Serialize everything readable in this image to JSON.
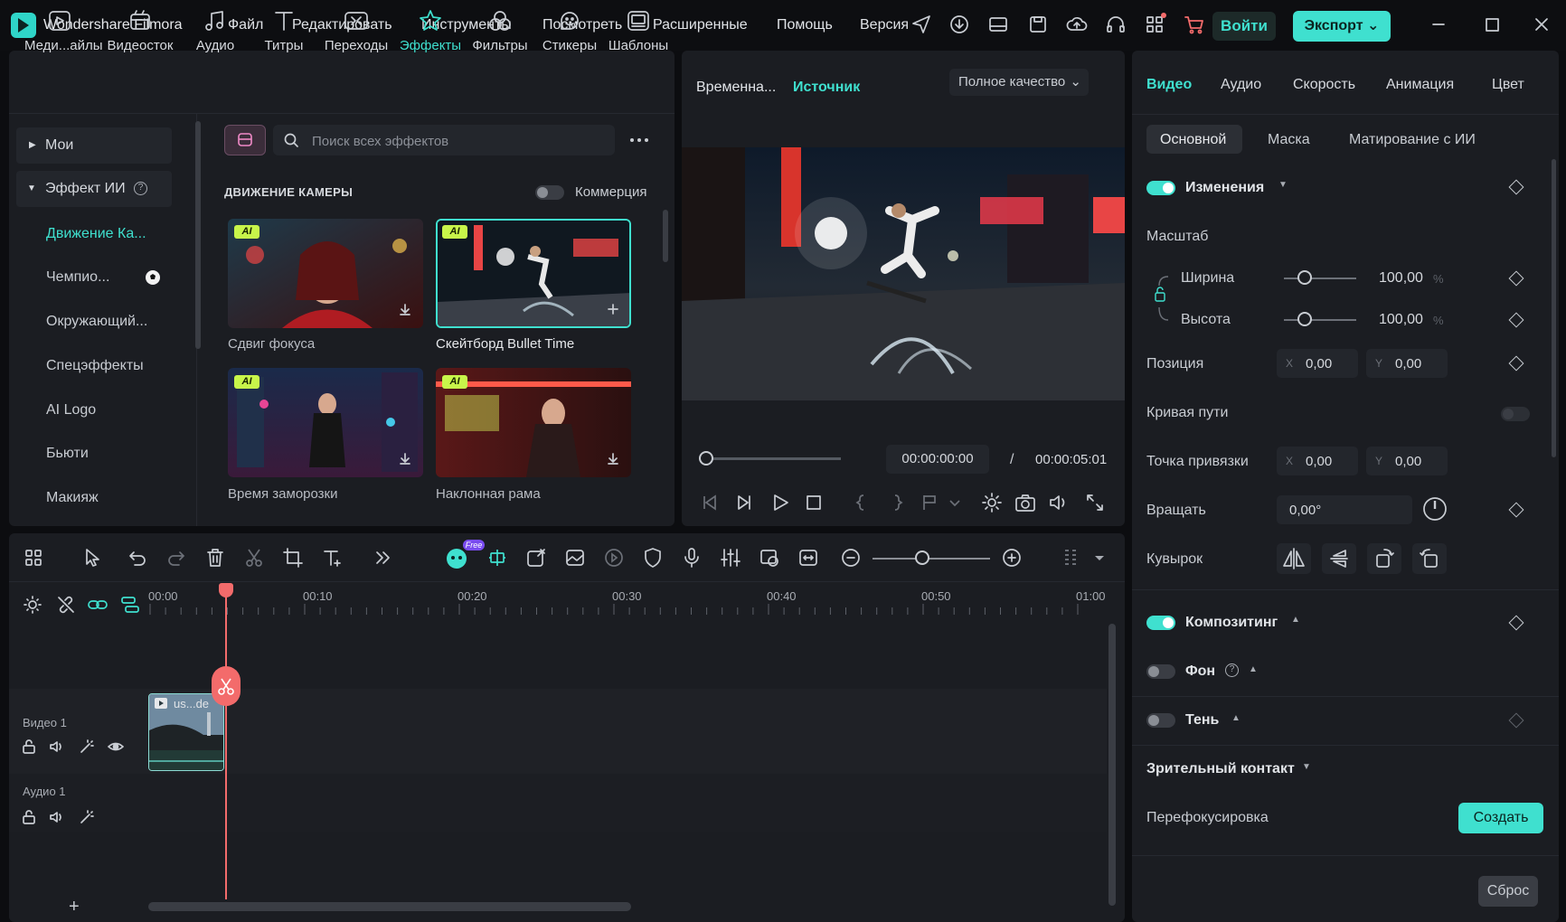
{
  "titlebar": {
    "app_name": "Wondershare Filmora",
    "menus": [
      "Файл",
      "Редактировать",
      "Инструменты",
      "Посмотреть",
      "Расширенные",
      "Помощь",
      "Версия"
    ],
    "login": "Войти",
    "export": "Экспорт"
  },
  "media_toolbar": {
    "items": [
      {
        "label": "Меди...айлы",
        "icon": "media-icon"
      },
      {
        "label": "Видеосток",
        "icon": "stock-video-icon"
      },
      {
        "label": "Аудио",
        "icon": "music-note-icon"
      },
      {
        "label": "Титры",
        "icon": "text-t-icon"
      },
      {
        "label": "Переходы",
        "icon": "transitions-icon"
      },
      {
        "label": "Эффекты",
        "icon": "effects-sparkle-icon",
        "active": true
      },
      {
        "label": "Фильтры",
        "icon": "filters-icon"
      },
      {
        "label": "Стикеры",
        "icon": "sticker-icon"
      },
      {
        "label": "Шаблоны",
        "icon": "templates-icon"
      }
    ]
  },
  "library_sidebar": {
    "items": [
      {
        "label": "Мои",
        "type": "group"
      },
      {
        "label": "Эффект ИИ",
        "type": "group-open"
      },
      {
        "label": "Движение Ка...",
        "active": true
      },
      {
        "label": "Чемпио..."
      },
      {
        "label": "Окружающий..."
      },
      {
        "label": "Спецэффекты"
      },
      {
        "label": "AI Logo"
      },
      {
        "label": "Бьюти"
      },
      {
        "label": "Макияж"
      }
    ]
  },
  "effects": {
    "search_placeholder": "Поиск всех эффектов",
    "section_title": "ДВИЖЕНИЕ КАМЕРЫ",
    "commerce_label": "Коммерция",
    "badge": "AI",
    "cards": [
      {
        "label": "Сдвиг фокуса"
      },
      {
        "label": "Скейтборд Bullet Time",
        "selected": true
      },
      {
        "label": "Время заморозки"
      },
      {
        "label": "Наклонная рама"
      }
    ]
  },
  "preview": {
    "tab_timeline": "Временна...",
    "tab_source": "Источник",
    "quality": "Полное качество",
    "time_current": "00:00:00:00",
    "time_sep": "/",
    "time_total": "00:00:05:01"
  },
  "properties": {
    "tabs": [
      "Видео",
      "Аудио",
      "Скорость",
      "Анимация",
      "Цвет"
    ],
    "subtabs": [
      "Основной",
      "Маска",
      "Матирование с ИИ"
    ],
    "transform": "Изменения",
    "scale": "Масштаб",
    "width": "Ширина",
    "height": "Высота",
    "width_value": "100,00",
    "height_value": "100,00",
    "unit_percent": "%",
    "position": "Позиция",
    "pos_x": "0,00",
    "pos_y": "0,00",
    "path_curve": "Кривая пути",
    "anchor": "Точка привязки",
    "anchor_x": "0,00",
    "anchor_y": "0,00",
    "rotate": "Вращать",
    "rotate_value": "0,00°",
    "flip": "Кувырок",
    "compositing": "Композитинг",
    "background": "Фон",
    "shadow": "Тень",
    "eye_contact": "Зрительный контакт",
    "refocus": "Перефокусировка",
    "create": "Создать",
    "reset": "Сброс",
    "axis_x": "X",
    "axis_y": "Y"
  },
  "timeline": {
    "ruler": [
      "00:00",
      "00:10",
      "00:20",
      "00:30",
      "00:40",
      "00:50",
      "01:00"
    ],
    "video_track": "Видео 1",
    "audio_track": "Аудио 1",
    "clip_label": "us...de",
    "free_badge": "Free",
    "add": "+"
  },
  "colors": {
    "accent": "#3fe0cf",
    "playhead": "#f36b6b",
    "panel": "#1b1d22"
  }
}
